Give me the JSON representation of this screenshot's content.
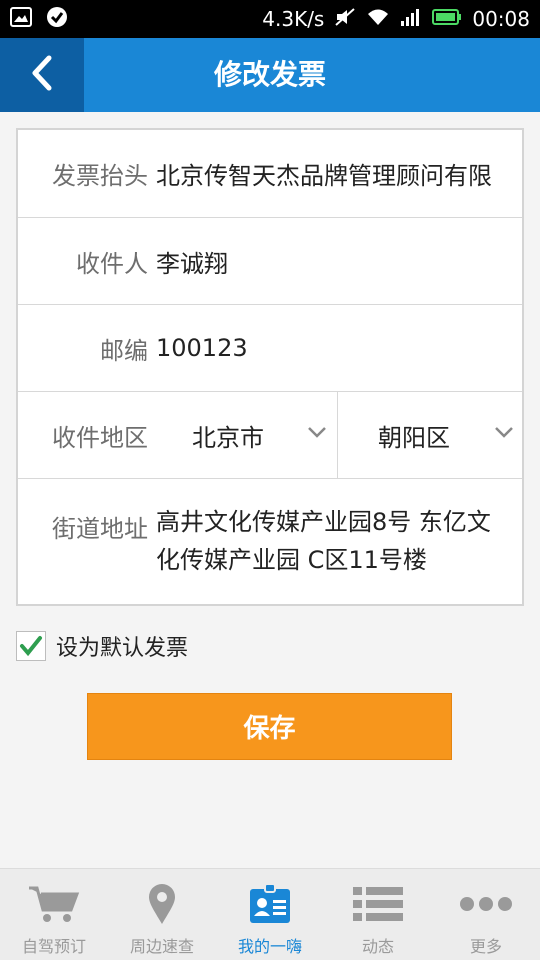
{
  "status_bar": {
    "speed": "4.3K/s",
    "time": "00:08"
  },
  "header": {
    "title": "修改发票"
  },
  "form": {
    "invoice_title": {
      "label": "发票抬头",
      "value": "北京传智天杰品牌管理顾问有限"
    },
    "recipient": {
      "label": "收件人",
      "value": "李诚翔"
    },
    "zip_code": {
      "label": "邮编",
      "value": "100123"
    },
    "region": {
      "label": "收件地区",
      "city": "北京市",
      "district": "朝阳区"
    },
    "address": {
      "label": "街道地址",
      "value": "高井文化传媒产业园8号 东亿文化传媒产业园 C区11号楼"
    }
  },
  "default_invoice": {
    "label": "设为默认发票",
    "checked": true
  },
  "save_button": {
    "label": "保存"
  },
  "bottom_nav": {
    "items": [
      {
        "label": "自驾预订",
        "icon": "cart-icon"
      },
      {
        "label": "周边速查",
        "icon": "location-pin-icon"
      },
      {
        "label": "我的一嗨",
        "icon": "id-card-icon",
        "active": true
      },
      {
        "label": "动态",
        "icon": "list-icon"
      },
      {
        "label": "更多",
        "icon": "more-dots-icon"
      }
    ]
  },
  "colors": {
    "header": "#1a87d6",
    "back_button": "#0d5fa3",
    "accent_orange": "#f7961c",
    "check_green": "#2e9e4f"
  }
}
